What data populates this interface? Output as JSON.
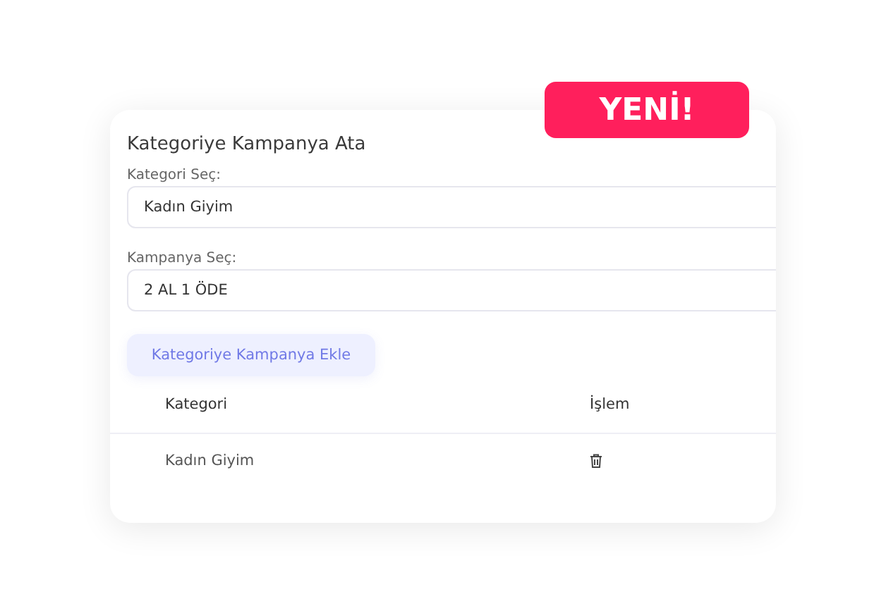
{
  "badge": "YENİ!",
  "form": {
    "title": "Kategoriye Kampanya Ata",
    "fields": [
      {
        "label": "Kategori Seç:",
        "value": "Kadın Giyim"
      },
      {
        "label": "Kampanya Seç:",
        "value": "2 AL 1 ÖDE"
      }
    ],
    "button": "Kategoriye Kampanya Ekle"
  },
  "table": {
    "columns": [
      "Kategori",
      "İşlem"
    ],
    "rows": [
      {
        "category": "Kadın Giyim"
      }
    ]
  }
}
